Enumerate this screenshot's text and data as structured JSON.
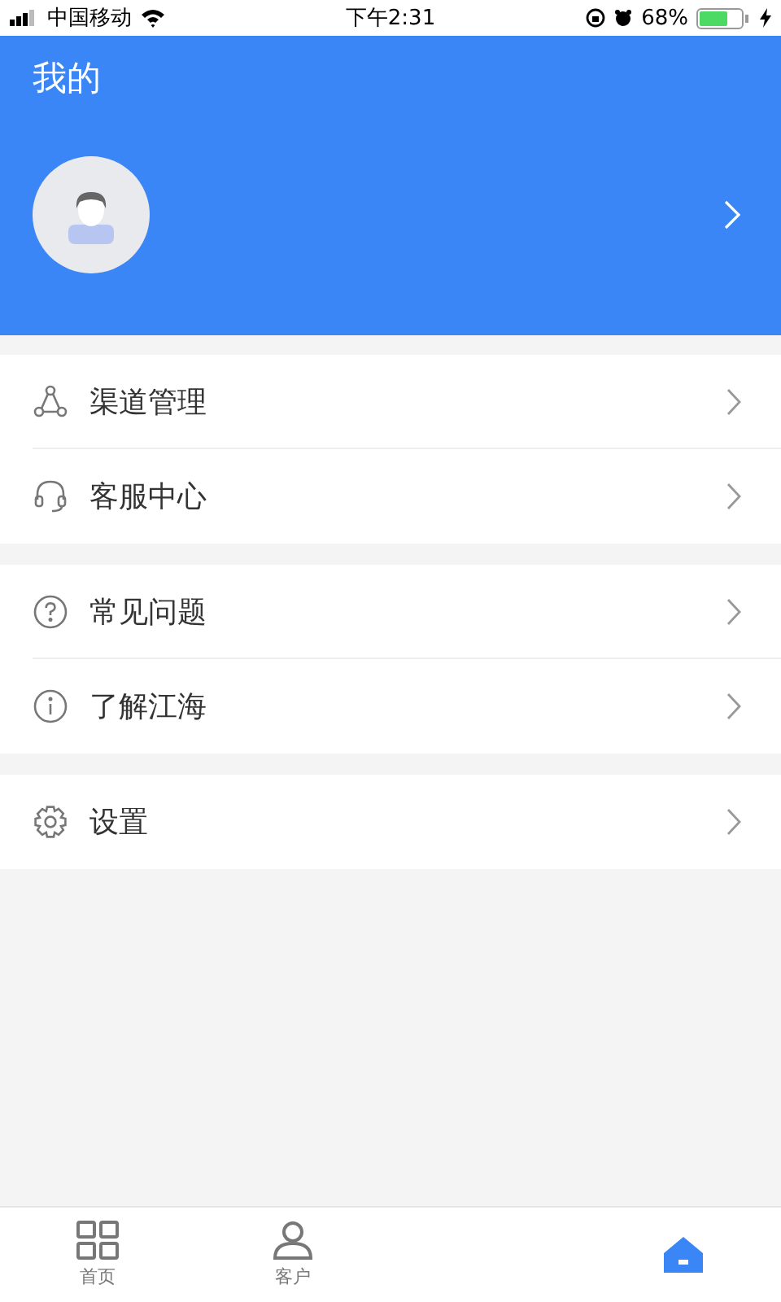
{
  "status_bar": {
    "carrier": "中国移动",
    "time": "下午2:31",
    "battery": "68%"
  },
  "header": {
    "title": "我的"
  },
  "menu_groups": [
    {
      "items": [
        {
          "label": "渠道管理",
          "kind": "channel"
        },
        {
          "label": "客服中心",
          "kind": "service"
        }
      ]
    },
    {
      "items": [
        {
          "label": "常见问题",
          "kind": "faq"
        },
        {
          "label": "了解江海",
          "kind": "about"
        }
      ]
    },
    {
      "items": [
        {
          "label": "设置",
          "kind": "settings"
        }
      ]
    }
  ],
  "tab_bar": [
    {
      "label": "首页",
      "kind": "home",
      "selected": false
    },
    {
      "label": "客户",
      "kind": "customer",
      "selected": false
    },
    {
      "kind": "mine",
      "selected": true
    }
  ]
}
